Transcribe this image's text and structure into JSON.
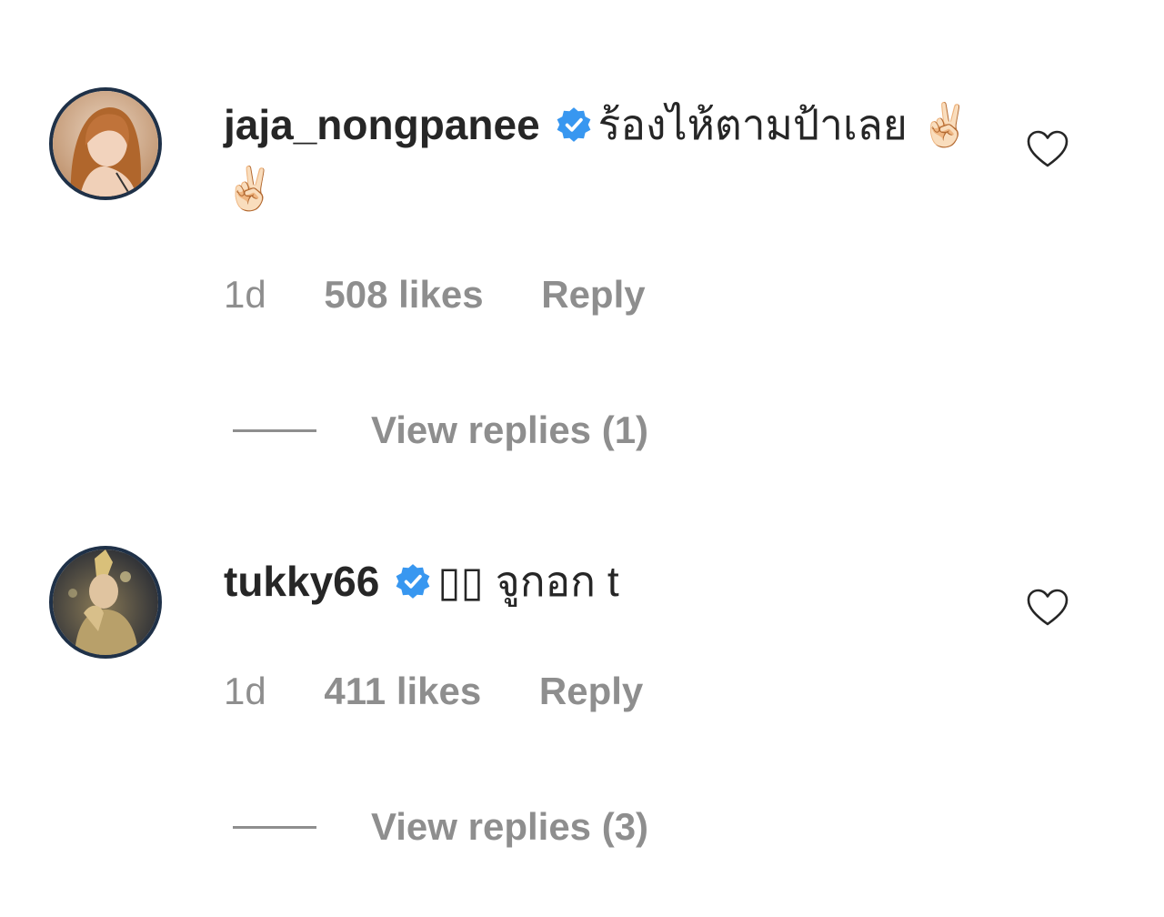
{
  "colors": {
    "text_primary": "#262626",
    "text_secondary": "#8e8e8e",
    "verified_blue": "#3897f0",
    "avatar_ring": "#1f3148"
  },
  "comments": [
    {
      "username": "jaja_nongpanee",
      "verified": true,
      "text": "ร้องไห้ตามป้าเลย ✌🏻 ✌🏻",
      "time": "1d",
      "likes": "508 likes",
      "reply_label": "Reply",
      "view_replies": "View replies (1)",
      "avatar_icon": "avatar-photo",
      "heart_icon": "heart-outline-icon"
    },
    {
      "username": "tukky66",
      "verified": true,
      "text": "\u0000\u0000 จูกอก t",
      "time": "1d",
      "likes": "411 likes",
      "reply_label": "Reply",
      "view_replies": "View replies (3)",
      "avatar_icon": "avatar-photo",
      "heart_icon": "heart-outline-icon"
    }
  ]
}
